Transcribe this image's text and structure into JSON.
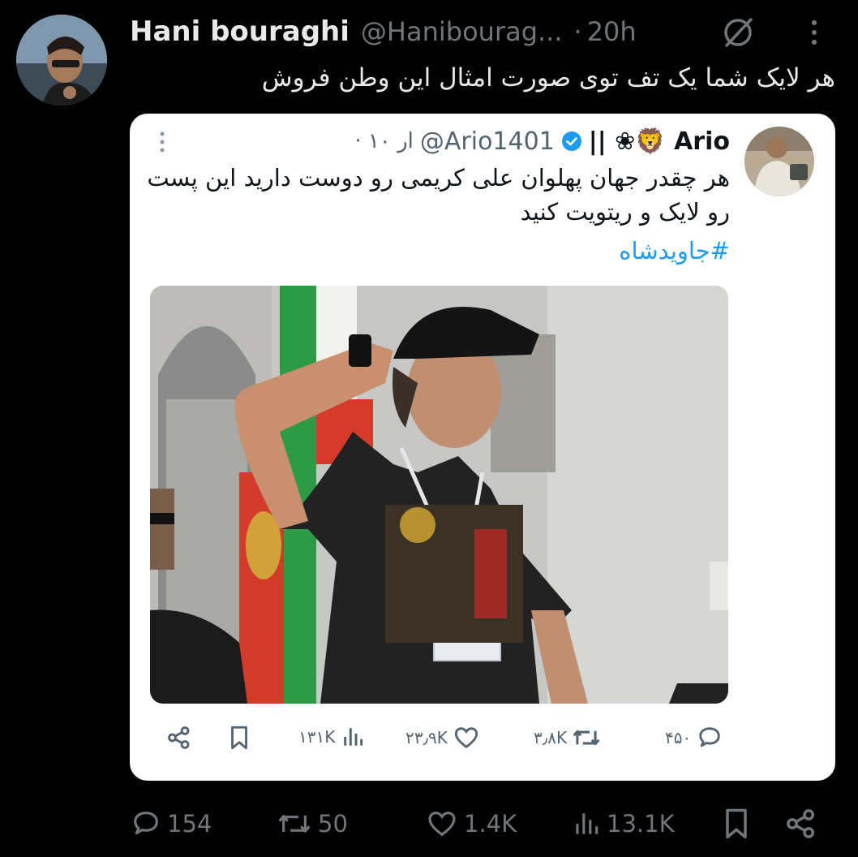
{
  "post": {
    "display_name": "Hani bouraghi",
    "handle": "@Hanibourag...",
    "separator": "·",
    "time": "20h",
    "text": "هر لایک شما یک تف توی صورت امثال این وطن فروش"
  },
  "quoted": {
    "display_name": "|| ❀🦁 Ario",
    "handle": "@Ario1401",
    "time": "· ۱۰ ار",
    "text": "هر چقدر جهان پهلوان علی کریمی رو دوست دارید این پست رو لایک و ریتویت کنید",
    "hashtag": "#جاویدشاه",
    "actions": {
      "replies": "۴۵۰",
      "retweets": "۳٫۸K",
      "likes": "۲۳٫۹K",
      "views": "۱۳۱K"
    }
  },
  "actions": {
    "replies": "154",
    "retweets": "50",
    "likes": "1.4K",
    "views": "13.1K"
  },
  "colors": {
    "background": "#000000",
    "primary_text": "#e7e9ea",
    "secondary_text": "#71767b",
    "link": "#1d9bf0",
    "verified": "#1d9bf0"
  },
  "icons": [
    "grok-icon",
    "more-icon",
    "verified-badge-icon",
    "reply-icon",
    "retweet-icon",
    "like-icon",
    "views-icon",
    "bookmark-icon",
    "share-icon"
  ]
}
